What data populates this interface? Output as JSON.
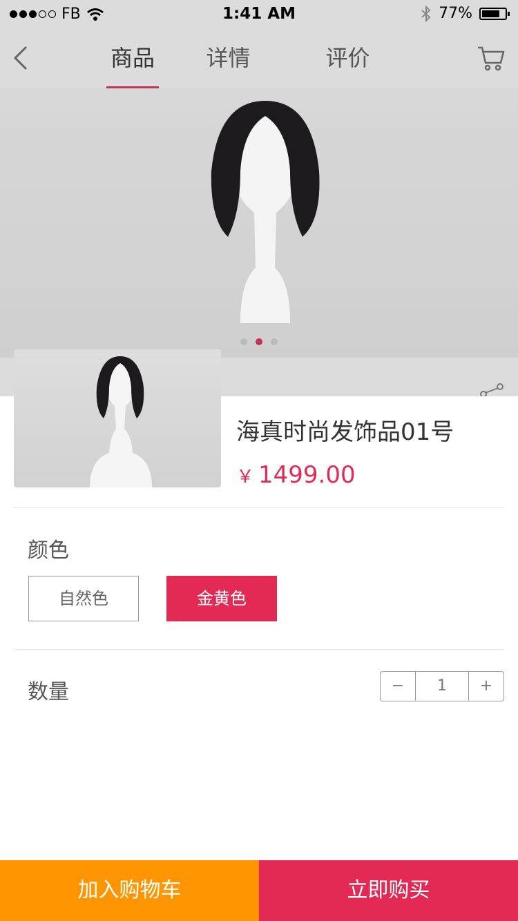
{
  "status_bar": {
    "carrier": "FB",
    "time": "1:41 AM",
    "battery": "77%",
    "battery_level": 0.77
  },
  "nav": {
    "tabs": [
      {
        "label": "商品",
        "active": true
      },
      {
        "label": "详情",
        "active": false
      },
      {
        "label": "评价",
        "active": false
      }
    ]
  },
  "carousel": {
    "count": 3,
    "active_index": 1
  },
  "product": {
    "name": "海真时尚发饰品01号",
    "currency": "￥",
    "price": "1499.00"
  },
  "color": {
    "label": "颜色",
    "options": [
      {
        "label": "自然色",
        "selected": false
      },
      {
        "label": "金黄色",
        "selected": true
      }
    ]
  },
  "quantity": {
    "label": "数量",
    "minus": "−",
    "value": "1",
    "plus": "+"
  },
  "footer": {
    "add_to_cart": "加入购物车",
    "buy_now": "立即购买"
  },
  "colors": {
    "accent": "#e32a55",
    "cart_orange": "#ff9500",
    "tab_underline": "#c2325a"
  }
}
